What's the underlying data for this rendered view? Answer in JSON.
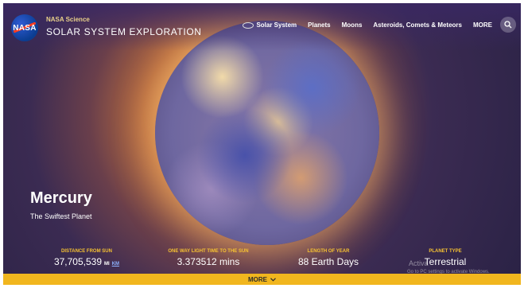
{
  "header": {
    "org_label": "NASA Science",
    "site_title": "SOLAR SYSTEM EXPLORATION",
    "logo_text": "NASA",
    "nav": [
      {
        "label": "Solar System"
      },
      {
        "label": "Planets"
      },
      {
        "label": "Moons"
      },
      {
        "label": "Asteroids, Comets & Meteors"
      },
      {
        "label": "MORE"
      }
    ]
  },
  "hero": {
    "planet_name": "Mercury",
    "tagline": "The Swiftest Planet"
  },
  "stats": [
    {
      "label": "DISTANCE FROM SUN",
      "value": "37,705,539",
      "unit_a": "MI",
      "unit_b": "KM"
    },
    {
      "label": "ONE WAY LIGHT TIME TO THE SUN",
      "value": "3.373512 mins"
    },
    {
      "label": "LENGTH OF YEAR",
      "value": "88 Earth Days"
    },
    {
      "label": "PLANET TYPE",
      "value": "Terrestrial"
    }
  ],
  "overlay": {
    "activate_head": "Activa",
    "activate_sub": "Go to PC settings to activate Windows."
  },
  "footer": {
    "more_label": "MORE"
  },
  "colors": {
    "accent_yellow": "#f1b61e",
    "stat_label": "#f6c232"
  }
}
